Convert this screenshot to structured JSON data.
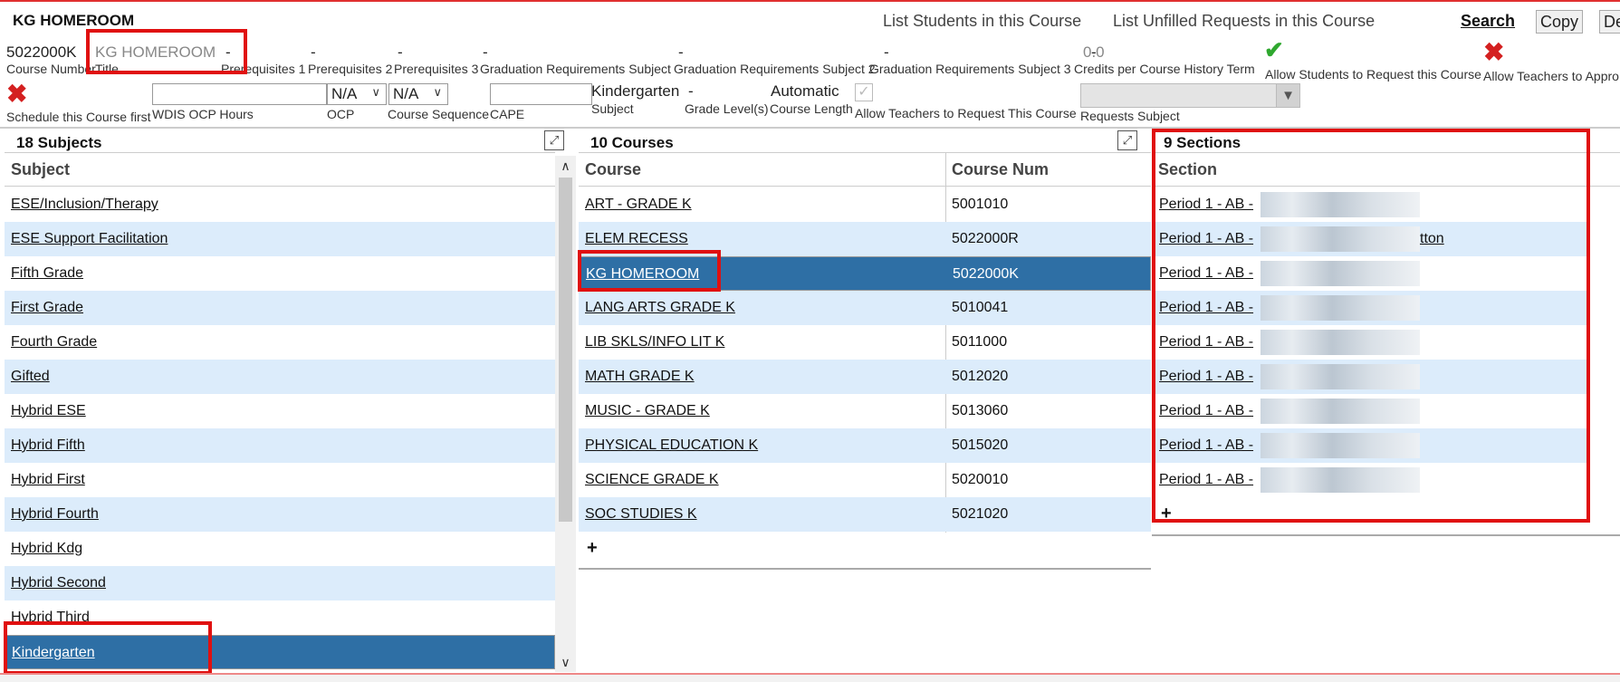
{
  "header": {
    "title": "KG HOMEROOM",
    "list_students": "List Students in this Course",
    "list_unfilled": "List Unfilled Requests in this Course",
    "search": "Search",
    "copy": "Copy",
    "delete_partial": "De"
  },
  "fields": {
    "course_number": {
      "value": "5022000K",
      "label": "Course Number"
    },
    "title": {
      "value": "KG HOMEROOM",
      "label": "Title"
    },
    "prereq1": {
      "value": "-",
      "label": "Prerequisites 1"
    },
    "prereq2": {
      "value": "-",
      "label": "Prerequisites 2"
    },
    "prereq3": {
      "value": "-",
      "label": "Prerequisites 3"
    },
    "grad_req_subject": {
      "value": "-",
      "label": "Graduation Requirements Subject"
    },
    "grad_req_subject2": {
      "value": "-",
      "label": "Graduation Requirements Subject 2"
    },
    "grad_req_subject3": {
      "value": "-",
      "label": "Graduation Requirements Subject 3"
    },
    "credits": {
      "value": "0.0",
      "label": "Credits per Course History Term"
    },
    "allow_students_request": {
      "label": "Allow Students to Request this Course"
    },
    "allow_teachers_approve": {
      "label": "Allow Teachers to Appro"
    },
    "schedule_first": {
      "label": "Schedule this Course first"
    },
    "wdis_ocp_hours": {
      "value": "",
      "label": "WDIS OCP Hours"
    },
    "ocp": {
      "value": "N/A",
      "label": "OCP"
    },
    "course_sequence": {
      "value": "N/A",
      "label": "Course Sequence"
    },
    "cape": {
      "value": "",
      "label": "CAPE"
    },
    "subject": {
      "value": "Kindergarten",
      "label": "Subject"
    },
    "grade_levels": {
      "value": "-",
      "label": "Grade Level(s)"
    },
    "course_length": {
      "value": "Automatic",
      "label": "Course Length"
    },
    "allow_teachers_request": {
      "label": "Allow Teachers to Request This Course"
    },
    "requests_subject": {
      "value": "",
      "label": "Requests Subject"
    }
  },
  "subjects": {
    "title": "18 Subjects",
    "column": "Subject",
    "items": [
      "ESE/Inclusion/Therapy",
      "ESE Support Facilitation",
      "Fifth Grade",
      "First Grade",
      "Fourth Grade",
      "Gifted",
      "Hybrid ESE",
      "Hybrid Fifth",
      "Hybrid First",
      "Hybrid Fourth",
      "Hybrid Kdg",
      "Hybrid Second",
      "Hybrid Third",
      "Kindergarten"
    ],
    "selected_index": 13
  },
  "courses": {
    "title": "10 Courses",
    "columns": [
      "Course",
      "Course Num"
    ],
    "rows": [
      {
        "name": "ART - GRADE K",
        "num": "5001010"
      },
      {
        "name": "ELEM RECESS",
        "num": "5022000R"
      },
      {
        "name": "KG HOMEROOM",
        "num": "5022000K"
      },
      {
        "name": "LANG ARTS GRADE K",
        "num": "5010041"
      },
      {
        "name": "LIB SKLS/INFO LIT K",
        "num": "5011000"
      },
      {
        "name": "MATH GRADE K",
        "num": "5012020"
      },
      {
        "name": "MUSIC - GRADE K",
        "num": "5013060"
      },
      {
        "name": "PHYSICAL EDUCATION K",
        "num": "5015020"
      },
      {
        "name": "SCIENCE GRADE K",
        "num": "5020010"
      },
      {
        "name": "SOC STUDIES K",
        "num": "5021020"
      }
    ],
    "selected_index": 2,
    "add": "+"
  },
  "sections": {
    "title": "9 Sections",
    "column": "Section",
    "rows": [
      {
        "label": "Period 1 - AB -",
        "suffix": ""
      },
      {
        "label": "Period 1 - AB -",
        "suffix": "tton"
      },
      {
        "label": "Period 1 - AB -",
        "suffix": ""
      },
      {
        "label": "Period 1 - AB -",
        "suffix": ""
      },
      {
        "label": "Period 1 - AB -",
        "suffix": ""
      },
      {
        "label": "Period 1 - AB -",
        "suffix": ""
      },
      {
        "label": "Period 1 - AB -",
        "suffix": ""
      },
      {
        "label": "Period 1 - AB -",
        "suffix": ""
      },
      {
        "label": "Period 1 - AB -",
        "suffix": ""
      }
    ],
    "add": "+"
  },
  "icons": {
    "check": "check-icon",
    "cross": "x-icon",
    "expand": "expand-icon",
    "chevron": "chevron-down-icon"
  },
  "colors": {
    "selected_row": "#2e6fa5",
    "alt_row": "#dcecfb",
    "annotation": "#e01010"
  }
}
